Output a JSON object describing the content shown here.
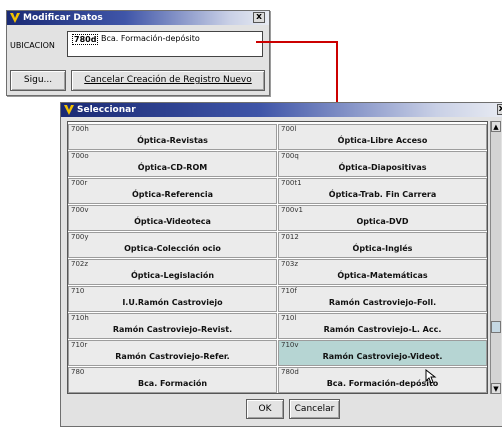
{
  "modificar": {
    "title": "Modificar Datos",
    "close_glyph": "x",
    "field_label": "UBICACION",
    "field_code": "780d",
    "field_value": "Bca. Formación-depósito",
    "sigu_label": "Sigu...",
    "cancel_label": "Cancelar Creación de Registro Nuevo"
  },
  "seleccionar": {
    "title": "Seleccionar",
    "close_glyph": "x",
    "ok_label": "OK",
    "cancel_label": "Cancelar",
    "selected_index": 17,
    "items": [
      {
        "code": "700h",
        "label": "Óptica-Revistas"
      },
      {
        "code": "700l",
        "label": "Óptica-Libre Acceso"
      },
      {
        "code": "700o",
        "label": "Óptica-CD-ROM"
      },
      {
        "code": "700q",
        "label": "Óptica-Diapositivas"
      },
      {
        "code": "700r",
        "label": "Óptica-Referencia"
      },
      {
        "code": "700t1",
        "label": "Óptica-Trab. Fin Carrera"
      },
      {
        "code": "700v",
        "label": "Óptica-Videoteca"
      },
      {
        "code": "700v1",
        "label": "Optica-DVD"
      },
      {
        "code": "700y",
        "label": "Optica-Colección ocio"
      },
      {
        "code": "7012",
        "label": "Óptica-Inglés"
      },
      {
        "code": "702z",
        "label": "Óptica-Legislación"
      },
      {
        "code": "703z",
        "label": "Óptica-Matemáticas"
      },
      {
        "code": "710",
        "label": "I.U.Ramón Castroviejo"
      },
      {
        "code": "710f",
        "label": "Ramón Castroviejo-Foll."
      },
      {
        "code": "710h",
        "label": "Ramón Castroviejo-Revist."
      },
      {
        "code": "710l",
        "label": "Ramón Castroviejo-L. Acc."
      },
      {
        "code": "710r",
        "label": "Ramón Castroviejo-Refer."
      },
      {
        "code": "710v",
        "label": "Ramón Castroviejo-Videot."
      },
      {
        "code": "780",
        "label": "Bca. Formación"
      },
      {
        "code": "780d",
        "label": "Bca. Formación-depósito"
      }
    ]
  },
  "icons": {
    "window_icon": "app-v-icon",
    "scroll_up": "scroll-up-arrow-icon",
    "scroll_down": "scroll-down-arrow-icon",
    "cursor": "mouse-pointer-icon"
  },
  "colors": {
    "selected_cell": "#b6d5d3",
    "connector": "#cc0000",
    "titlebar": "#1a2a74"
  }
}
